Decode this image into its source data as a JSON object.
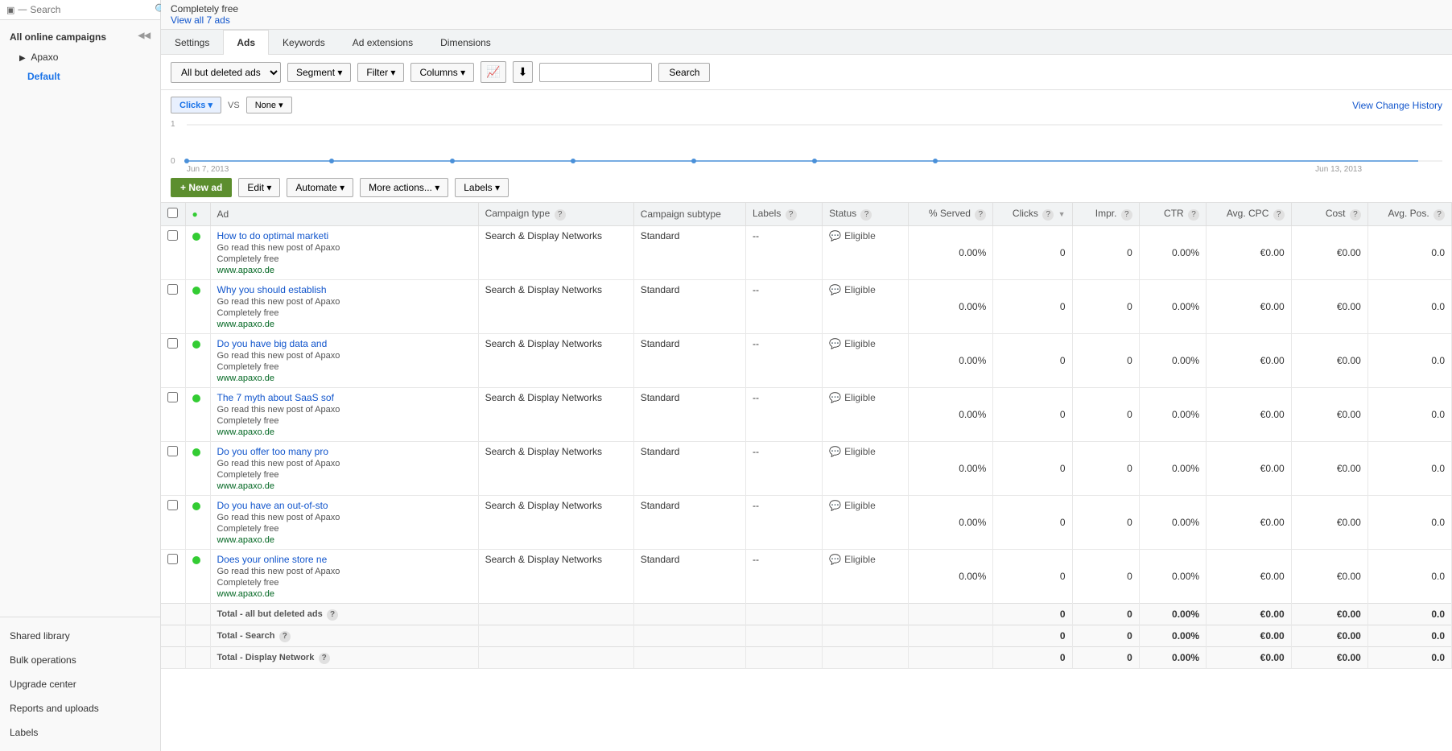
{
  "sidebar": {
    "search_placeholder": "Search",
    "title": "Search",
    "all_campaigns_label": "All online campaigns",
    "campaign_name": "Apaxo",
    "ad_group_name": "Default",
    "collapse_btn": "◀◀",
    "bottom_items": [
      {
        "id": "shared-library",
        "label": "Shared library"
      },
      {
        "id": "bulk-operations",
        "label": "Bulk operations"
      },
      {
        "id": "upgrade-center",
        "label": "Upgrade center"
      },
      {
        "id": "reports-and-uploads",
        "label": "Reports and uploads"
      },
      {
        "id": "labels",
        "label": "Labels"
      }
    ]
  },
  "top_banner": {
    "free_text": "Completely free",
    "view_all_link": "View all 7 ads"
  },
  "tabs": [
    {
      "id": "settings",
      "label": "Settings"
    },
    {
      "id": "ads",
      "label": "Ads",
      "active": true
    },
    {
      "id": "keywords",
      "label": "Keywords"
    },
    {
      "id": "ad-extensions",
      "label": "Ad extensions"
    },
    {
      "id": "dimensions",
      "label": "Dimensions"
    }
  ],
  "toolbar": {
    "filter_ads_label": "All but deleted ads",
    "segment_label": "Segment",
    "filter_label": "Filter",
    "columns_label": "Columns",
    "search_placeholder": "",
    "search_button_label": "Search"
  },
  "chart": {
    "metric_btn_label": "Clicks",
    "vs_label": "VS",
    "none_label": "None",
    "view_change_history": "View Change History",
    "x_start": "Jun 7, 2013",
    "x_end": "Jun 13, 2013",
    "y_value_top": "1",
    "y_value_bottom": "0"
  },
  "action_bar": {
    "new_ad_label": "+ New ad",
    "edit_label": "Edit",
    "automate_label": "Automate",
    "more_actions_label": "More actions...",
    "labels_label": "Labels"
  },
  "table": {
    "headers": [
      {
        "id": "ad",
        "label": "Ad"
      },
      {
        "id": "campaign-type",
        "label": "Campaign type",
        "help": true
      },
      {
        "id": "campaign-subtype",
        "label": "Campaign subtype"
      },
      {
        "id": "labels",
        "label": "Labels",
        "help": true
      },
      {
        "id": "status",
        "label": "Status",
        "help": true
      },
      {
        "id": "pct-served",
        "label": "% Served",
        "help": true
      },
      {
        "id": "clicks",
        "label": "Clicks",
        "help": true,
        "sort": true
      },
      {
        "id": "impr",
        "label": "Impr.",
        "help": true
      },
      {
        "id": "ctr",
        "label": "CTR",
        "help": true
      },
      {
        "id": "avg-cpc",
        "label": "Avg. CPC",
        "help": true
      },
      {
        "id": "cost",
        "label": "Cost",
        "help": true
      },
      {
        "id": "avg-pos",
        "label": "Avg. Pos.",
        "help": true
      }
    ],
    "rows": [
      {
        "title": "How to do optimal marketi",
        "desc": "Go read this new post of Apaxo",
        "free": "Completely free",
        "url": "www.apaxo.de",
        "campaign_type": "Search & Display Networks",
        "subtype": "Standard",
        "labels": "--",
        "status": "Eligible",
        "pct_served": "0.00%",
        "clicks": "0",
        "impr": "0",
        "ctr": "0.00%",
        "avg_cpc": "€0.00",
        "cost": "€0.00",
        "avg_pos": "0.0"
      },
      {
        "title": "Why you should establish",
        "desc": "Go read this new post of Apaxo",
        "free": "Completely free",
        "url": "www.apaxo.de",
        "campaign_type": "Search & Display Networks",
        "subtype": "Standard",
        "labels": "--",
        "status": "Eligible",
        "pct_served": "0.00%",
        "clicks": "0",
        "impr": "0",
        "ctr": "0.00%",
        "avg_cpc": "€0.00",
        "cost": "€0.00",
        "avg_pos": "0.0"
      },
      {
        "title": "Do you have big data and",
        "desc": "Go read this new post of Apaxo",
        "free": "Completely free",
        "url": "www.apaxo.de",
        "campaign_type": "Search & Display Networks",
        "subtype": "Standard",
        "labels": "--",
        "status": "Eligible",
        "pct_served": "0.00%",
        "clicks": "0",
        "impr": "0",
        "ctr": "0.00%",
        "avg_cpc": "€0.00",
        "cost": "€0.00",
        "avg_pos": "0.0"
      },
      {
        "title": "The 7 myth about SaaS sof",
        "desc": "Go read this new post of Apaxo",
        "free": "Completely free",
        "url": "www.apaxo.de",
        "campaign_type": "Search & Display Networks",
        "subtype": "Standard",
        "labels": "--",
        "status": "Eligible",
        "pct_served": "0.00%",
        "clicks": "0",
        "impr": "0",
        "ctr": "0.00%",
        "avg_cpc": "€0.00",
        "cost": "€0.00",
        "avg_pos": "0.0"
      },
      {
        "title": "Do you offer too many pro",
        "desc": "Go read this new post of Apaxo",
        "free": "Completely free",
        "url": "www.apaxo.de",
        "campaign_type": "Search & Display Networks",
        "subtype": "Standard",
        "labels": "--",
        "status": "Eligible",
        "pct_served": "0.00%",
        "clicks": "0",
        "impr": "0",
        "ctr": "0.00%",
        "avg_cpc": "€0.00",
        "cost": "€0.00",
        "avg_pos": "0.0"
      },
      {
        "title": "Do you have an out-of-sto",
        "desc": "Go read this new post of Apaxo",
        "free": "Completely free",
        "url": "www.apaxo.de",
        "campaign_type": "Search & Display Networks",
        "subtype": "Standard",
        "labels": "--",
        "status": "Eligible",
        "pct_served": "0.00%",
        "clicks": "0",
        "impr": "0",
        "ctr": "0.00%",
        "avg_cpc": "€0.00",
        "cost": "€0.00",
        "avg_pos": "0.0"
      },
      {
        "title": "Does your online store ne",
        "desc": "Go read this new post of Apaxo",
        "free": "Completely free",
        "url": "www.apaxo.de",
        "campaign_type": "Search & Display Networks",
        "subtype": "Standard",
        "labels": "--",
        "status": "Eligible",
        "pct_served": "0.00%",
        "clicks": "0",
        "impr": "0",
        "ctr": "0.00%",
        "avg_cpc": "€0.00",
        "cost": "€0.00",
        "avg_pos": "0.0"
      }
    ],
    "totals": [
      {
        "label": "Total - all but deleted ads",
        "help": true,
        "clicks": "0",
        "impr": "0",
        "ctr": "0.00%",
        "avg_cpc": "€0.00",
        "cost": "€0.00",
        "avg_pos": "0.0"
      },
      {
        "label": "Total - Search",
        "help": true,
        "clicks": "0",
        "impr": "0",
        "ctr": "0.00%",
        "avg_cpc": "€0.00",
        "cost": "€0.00",
        "avg_pos": "0.0"
      },
      {
        "label": "Total - Display Network",
        "help": true,
        "clicks": "0",
        "impr": "0",
        "ctr": "0.00%",
        "avg_cpc": "€0.00",
        "cost": "€0.00",
        "avg_pos": "0.0"
      }
    ]
  }
}
